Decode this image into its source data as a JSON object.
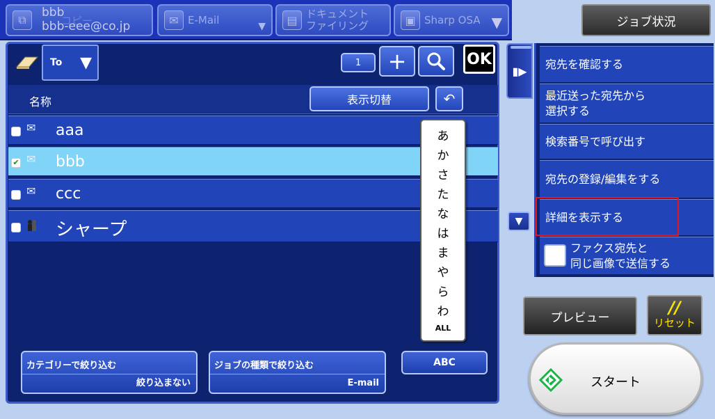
{
  "header": {
    "tabs": {
      "copy": {
        "label": "コピー",
        "overlay_line1": "bbb",
        "overlay_line2": "bbb-eee@co.jp"
      },
      "email": {
        "label": "E-Mail"
      },
      "document_filing": {
        "line1": "ドキュメント",
        "line2": "ファイリング"
      },
      "sharp_osa": {
        "label": "Sharp OSA"
      }
    },
    "job_status_label": "ジョブ状況"
  },
  "address_panel": {
    "to_label": "To",
    "count": "1",
    "ok_label": "OK",
    "name_header": "名称",
    "toggle_view_label": "表示切替",
    "rows": [
      {
        "name": "aaa",
        "icon": "envelope-icon",
        "checked": false
      },
      {
        "name": "bbb",
        "icon": "envelope-icon",
        "checked": true
      },
      {
        "name": "ccc",
        "icon": "envelope-icon",
        "checked": false
      },
      {
        "name": "シャープ",
        "icon": "group-icon",
        "checked": false
      }
    ],
    "kana_index": [
      "あ",
      "か",
      "さ",
      "た",
      "な",
      "は",
      "ま",
      "や",
      "ら",
      "わ",
      "ALL"
    ],
    "category_filter": {
      "title": "カテゴリーで絞り込む",
      "value": "絞り込まない"
    },
    "job_type_filter": {
      "title": "ジョブの種類で絞り込む",
      "value": "E-mail"
    },
    "abc_label": "ABC"
  },
  "action_menu": {
    "items": [
      "宛先を確認する",
      "最近送った宛先から\n選択する",
      "検索番号で呼び出す",
      "宛先の登録/編集をする",
      "詳細を表示する"
    ],
    "fax_same_image": {
      "line1": "ファクス宛先と",
      "line2": "同じ画像で送信する",
      "checked": false
    }
  },
  "controls": {
    "preview_label": "プレビュー",
    "reset_label": "リセット",
    "start_label": "スタート"
  },
  "colors": {
    "panel_bg": "#0d2370",
    "row_bg": "#2145b8",
    "selected_row_bg": "#80d4f8",
    "highlight_border": "#e8141e",
    "reset_text": "#ffe500",
    "start_icon": "#1db34a"
  }
}
